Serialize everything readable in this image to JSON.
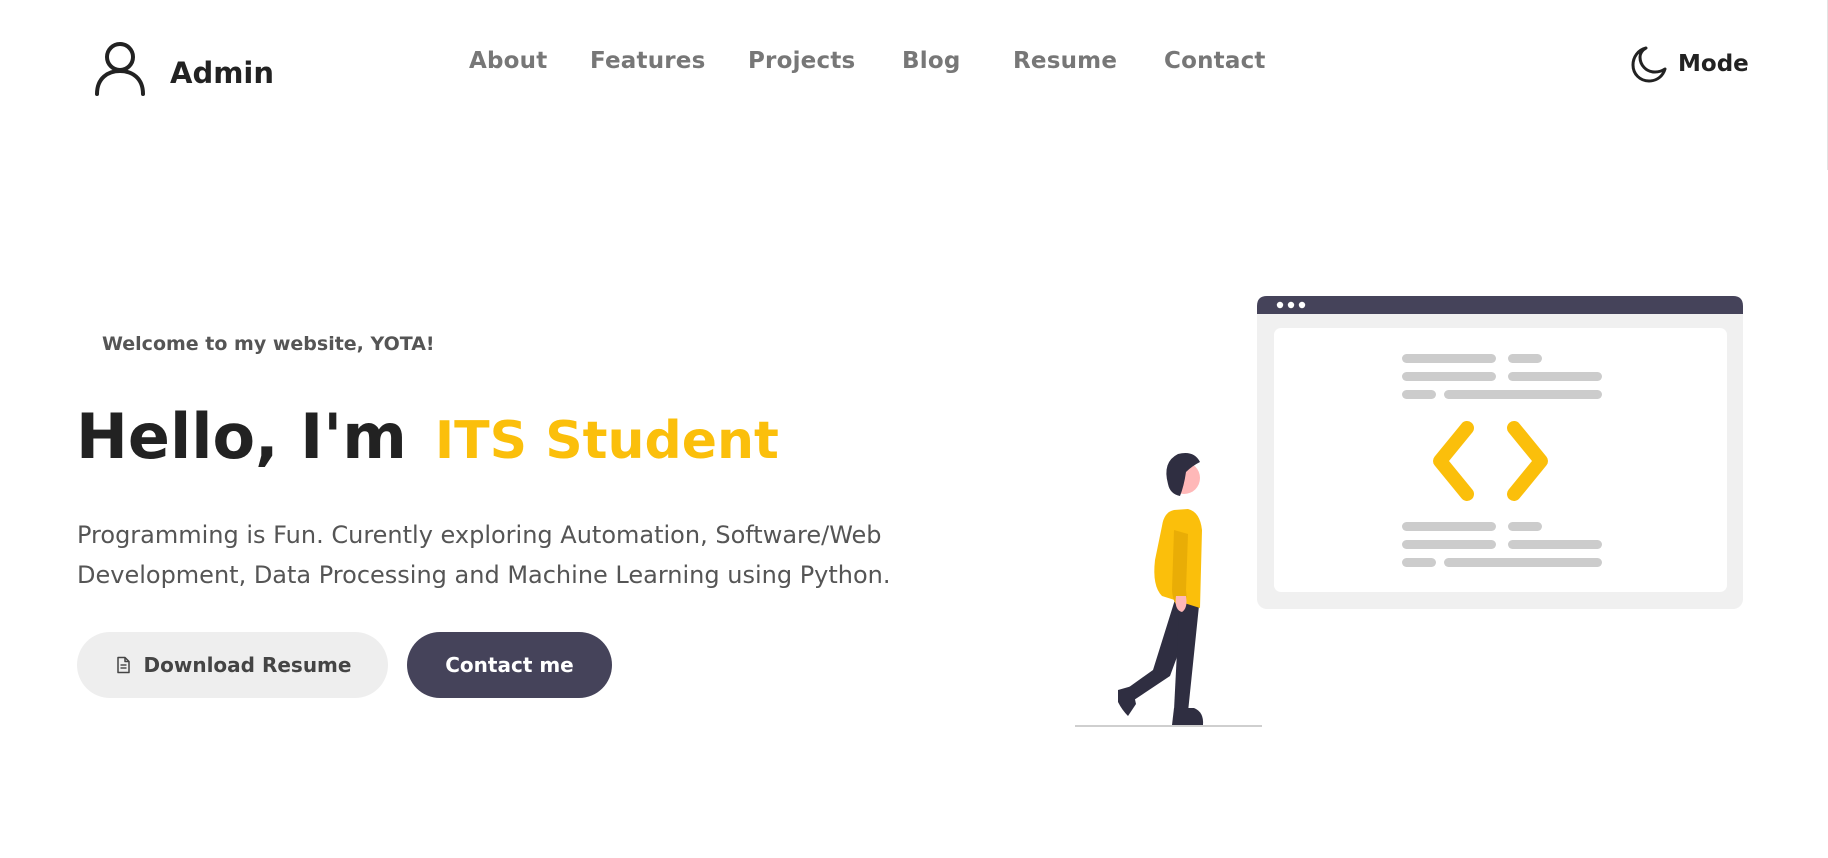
{
  "header": {
    "brand": {
      "icon": "user-icon",
      "text": "Admin"
    },
    "nav": [
      {
        "label": "About"
      },
      {
        "label": "Features"
      },
      {
        "label": "Projects"
      },
      {
        "label": "Blog"
      },
      {
        "label": "Resume"
      },
      {
        "label": "Contact"
      }
    ],
    "mode_toggle": {
      "icon": "moon-icon",
      "label": "Mode"
    }
  },
  "hero": {
    "welcome": "Welcome to my website, YOTA!",
    "greeting": "Hello, I'm",
    "highlight": "ITS Student",
    "description": "Programming is Fun. Curently exploring Automation, Software/Web Development, Data Processing and Machine Learning using Python.",
    "buttons": {
      "resume": {
        "icon": "document-icon",
        "label": "Download Resume"
      },
      "contact": {
        "label": "Contact me"
      }
    }
  },
  "colors": {
    "accent": "#fbbf0b",
    "dark": "#45435a",
    "text": "#222222",
    "muted": "#777777",
    "light_gray": "#eeeeee"
  },
  "illustration": {
    "name": "person-walking-to-code-window",
    "icon": "code-brackets-icon"
  }
}
